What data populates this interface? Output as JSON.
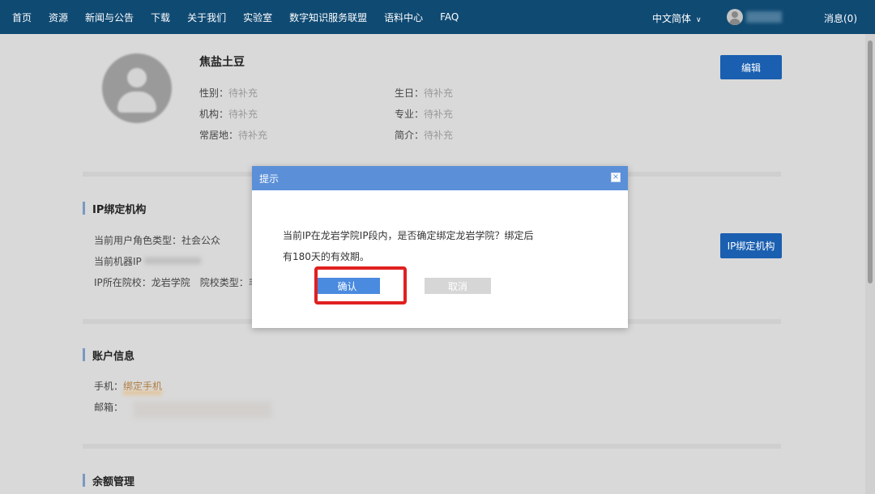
{
  "nav": {
    "items": [
      "首页",
      "资源",
      "新闻与公告",
      "下载",
      "关于我们",
      "实验室",
      "数字知识服务联盟",
      "语料中心",
      "FAQ"
    ],
    "language": "中文简体",
    "messages": "消息(0)"
  },
  "profile": {
    "name": "焦盐土豆",
    "edit_label": "编辑",
    "fields": {
      "gender": {
        "label": "性别：",
        "value": "待补充"
      },
      "birthday": {
        "label": "生日：",
        "value": "待补充"
      },
      "org": {
        "label": "机构：",
        "value": "待补充"
      },
      "major": {
        "label": "专业：",
        "value": "待补充"
      },
      "residence": {
        "label": "常居地：",
        "value": "待补充"
      },
      "intro": {
        "label": "简介：",
        "value": "待补充"
      }
    }
  },
  "ip_section": {
    "title": "IP绑定机构",
    "role_label": "当前用户角色类型：",
    "role_value": "社会公众",
    "ip_label": "当前机器IP",
    "school_label": "IP所在院校：",
    "school_value": "龙岩学院",
    "school_type_label": "院校类型：",
    "school_type_value": "非",
    "bind_button": "IP绑定机构"
  },
  "account_section": {
    "title": "账户信息",
    "phone_label": "手机：",
    "phone_value": "绑定手机",
    "email_label": "邮箱："
  },
  "balance_section": {
    "title": "余额管理"
  },
  "modal": {
    "title": "提示",
    "close": "×",
    "message_line1": "当前IP在龙岩学院IP段内，是否确定绑定龙岩学院？绑定后",
    "message_line2": "有180天的有效期。",
    "confirm": "确认",
    "cancel": "取消"
  },
  "colors": {
    "nav_bg": "#0f4a73",
    "modal_header": "#5b8fd8",
    "highlight": "#e02020",
    "primary_button": "#1a5fb0"
  }
}
